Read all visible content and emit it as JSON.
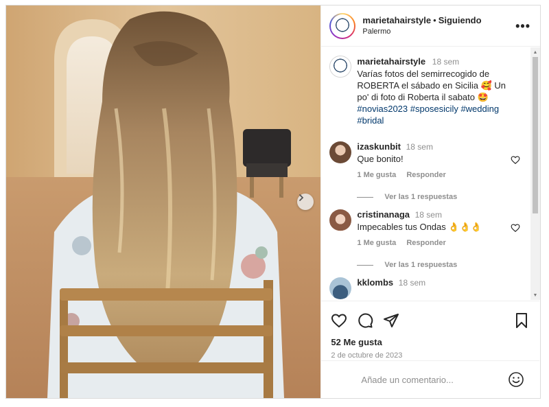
{
  "header": {
    "username": "marietahairstyle",
    "separator": "•",
    "follow_status": "Siguiendo",
    "location": "Palermo",
    "more_icon": "more-options-icon",
    "more_glyph": "•••"
  },
  "caption": {
    "username": "marietahairstyle",
    "time": "18 sem",
    "text": "Varías fotos del semirrecogido de ROBERTA el sábado en Sicilia 🥰 Un po' di foto di Roberta il sabato 🤩",
    "hashtags": "#novias2023 #sposesicily #wedding #bridal"
  },
  "comments": [
    {
      "username": "izaskunbit",
      "time": "18 sem",
      "text": "Que bonito!",
      "likes": "1 Me gusta",
      "reply": "Responder",
      "view_replies": "Ver las 1 respuestas"
    },
    {
      "username": "cristinanaga",
      "time": "18 sem",
      "text": "Impecables tus Ondas 👌👌👌",
      "likes": "1 Me gusta",
      "reply": "Responder",
      "view_replies": "Ver las 1 respuestas"
    },
    {
      "username": "kklombs",
      "time": "18 sem"
    }
  ],
  "stats": {
    "likes": "52 Me gusta",
    "date": "2 de octubre de 2023"
  },
  "add_comment": {
    "placeholder": "Añade un comentario..."
  },
  "scrollbar": {
    "up": "▲",
    "down": "▼"
  },
  "colors": {
    "text": "#262626",
    "muted": "#8e8e8e",
    "hashtag": "#00376b",
    "border": "#dbdbdb"
  }
}
